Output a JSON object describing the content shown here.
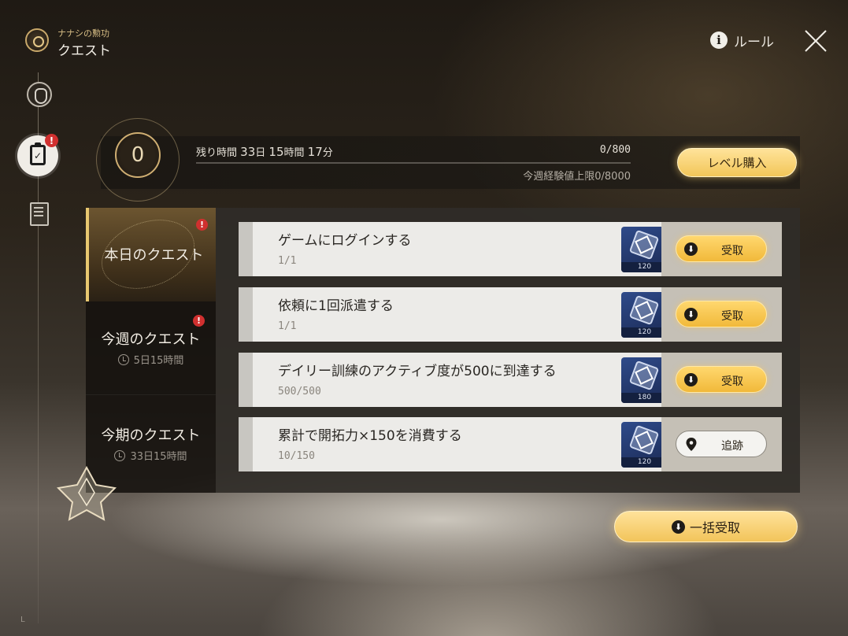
{
  "header": {
    "subtitle": "ナナシの勲功",
    "title": "クエスト",
    "rules_label": "ルール"
  },
  "level": {
    "value": "0",
    "remaining_label": "残り時間",
    "remaining_days": "33",
    "days_unit": "日",
    "remaining_hours": "15",
    "hours_unit": "時間",
    "remaining_minutes": "17",
    "minutes_unit": "分",
    "exp": "0/800",
    "weekly_cap": "今週経験値上限0/8000",
    "exp_progress": 0,
    "buy_label": "レベル購入"
  },
  "tabs": [
    {
      "label": "本日のクエスト",
      "sub": "",
      "badge": "!",
      "active": true
    },
    {
      "label": "今週のクエスト",
      "sub": "5日15時間",
      "badge": "!",
      "active": false
    },
    {
      "label": "今期のクエスト",
      "sub": "33日15時間",
      "badge": "",
      "active": false
    }
  ],
  "quests": [
    {
      "title": "ゲームにログインする",
      "progress": "1/1",
      "reward": "120",
      "action": "受取",
      "action_type": "claim"
    },
    {
      "title": "依頼に1回派遣する",
      "progress": "1/1",
      "reward": "120",
      "action": "受取",
      "action_type": "claim"
    },
    {
      "title": "デイリー訓練のアクティブ度が500に到達する",
      "progress": "500/500",
      "reward": "180",
      "action": "受取",
      "action_type": "claim"
    },
    {
      "title": "累計で開拓力×150を消費する",
      "progress": "10/150",
      "reward": "120",
      "action": "追跡",
      "action_type": "track"
    }
  ],
  "bulk_claim_label": "一括受取",
  "corner_mark": "L",
  "icons": {
    "brand": "emblem-icon",
    "info": "info-icon",
    "close": "close-icon",
    "rail": [
      "helmet-icon",
      "clipboard-check-icon",
      "document-search-icon"
    ],
    "claim": "download-icon",
    "track": "pin-icon",
    "clock": "clock-icon"
  },
  "colors": {
    "accent_gold": "#f2c659",
    "badge_red": "#d0302f",
    "reward_blue": "#2f4b8a"
  }
}
